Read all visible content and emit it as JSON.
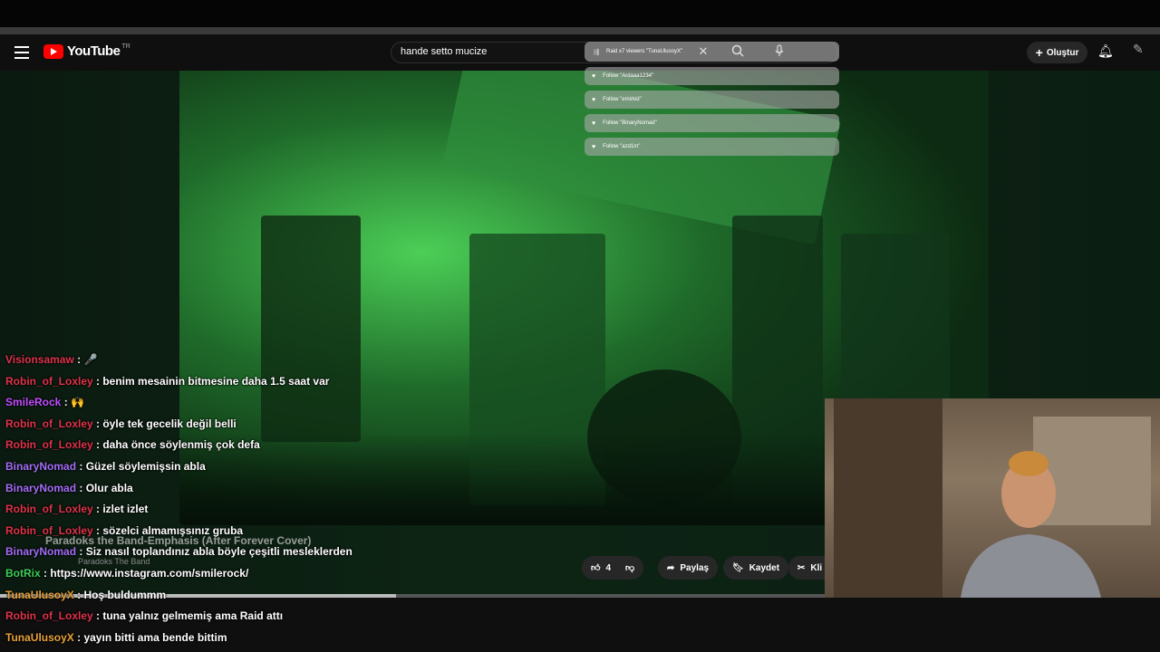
{
  "header": {
    "logo_text": "YouTube",
    "logo_region": "TR",
    "search_value": "hande setto mucize",
    "create_label": "Oluştur"
  },
  "overlay": {
    "raid_text": "Raid x7 viewers \"TunaUlusoyX\"",
    "follows": [
      {
        "text": "Follow \"Ardaaa1234\""
      },
      {
        "text": "Follow \"emirkid\""
      },
      {
        "text": "Follow \"BinaryNomad\""
      },
      {
        "text": "Follow \"azd1m\""
      }
    ]
  },
  "video": {
    "title": "Paradoks the Band-Emphasis (After Forever Cover)",
    "channel": "Paradoks The Band",
    "like_count": "4",
    "share_label": "Paylaş",
    "save_label": "Kaydet",
    "clip_label": "Kli",
    "progress": 0.48
  },
  "chat": [
    {
      "user": "Visionsamaw",
      "text": ": 🎤",
      "color": "#e0334a"
    },
    {
      "user": "Robin_of_Loxley",
      "text": ": benim mesainin bitmesine daha 1.5 saat var",
      "color": "#e0334a"
    },
    {
      "user": "SmileRock",
      "text": ": 🙌",
      "color": "#c04dff"
    },
    {
      "user": "Robin_of_Loxley",
      "text": ": öyle tek gecelik değil belli",
      "color": "#e0334a"
    },
    {
      "user": "Robin_of_Loxley",
      "text": ": daha önce söylenmiş çok defa",
      "color": "#e0334a"
    },
    {
      "user": "BinaryNomad",
      "text": ": Güzel söylemişsin abla",
      "color": "#a36df5"
    },
    {
      "user": "BinaryNomad",
      "text": ": Olur abla",
      "color": "#a36df5"
    },
    {
      "user": "Robin_of_Loxley",
      "text": ": izlet izlet",
      "color": "#e0334a"
    },
    {
      "user": "Robin_of_Loxley",
      "text": ": sözelci almamışsınız gruba",
      "color": "#e0334a"
    },
    {
      "user": "BinaryNomad",
      "text": ": Siz nasıl toplandınız abla böyle çeşitli mesleklerden",
      "color": "#a36df5"
    },
    {
      "user": "BotRix",
      "text": ": https://www.instagram.com/smilerock/",
      "color": "#3dd15a"
    },
    {
      "user": "TunaUlusoyX",
      "text": ": Hoş buldummm",
      "color": "#e8a23a"
    },
    {
      "user": "Robin_of_Loxley",
      "text": ": tuna yalnız gelmemiş ama Raid attı",
      "color": "#e0334a"
    },
    {
      "user": "TunaUlusoyX",
      "text": ": yayın bitti ama bende bittim",
      "color": "#e8a23a"
    }
  ],
  "icons": {
    "menu": "menu-icon",
    "search": "search-icon",
    "mic": "mic-icon",
    "close": "close-icon",
    "bell": "bell-icon",
    "like": "thumbs-up-icon",
    "dislike": "thumbs-down-icon",
    "share": "share-icon",
    "save": "bookmark-icon",
    "clip": "scissors-icon"
  }
}
